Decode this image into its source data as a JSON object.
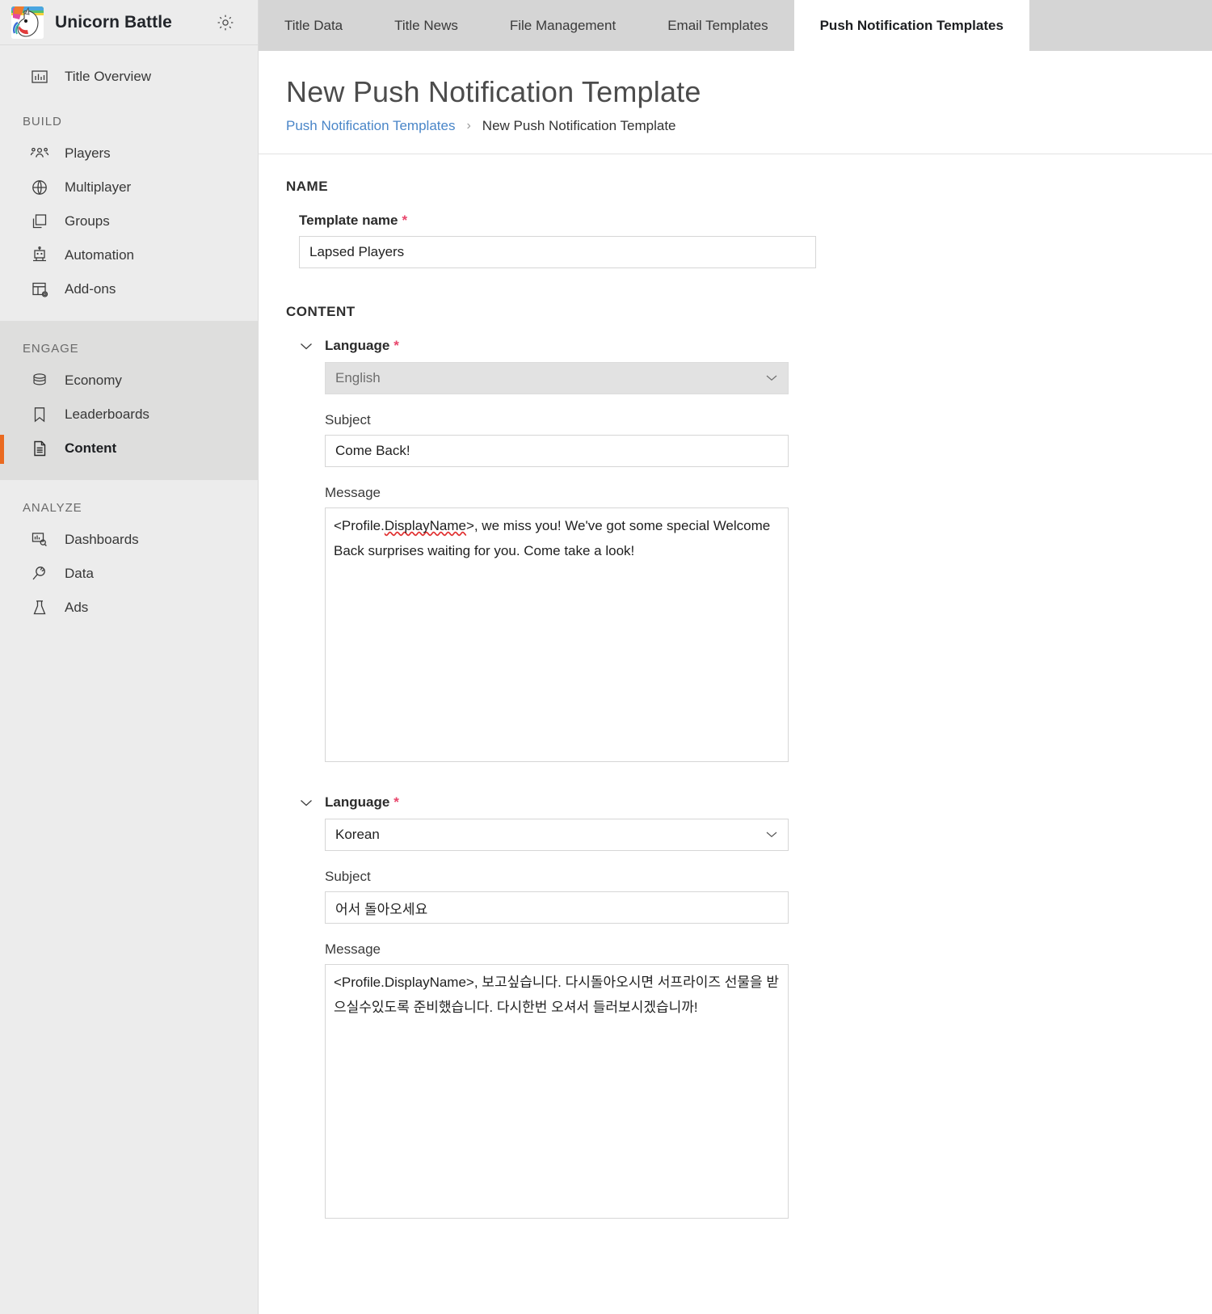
{
  "sidebar": {
    "brand": {
      "title": "Unicorn Battle",
      "logo_icon": "unicorn-logo",
      "settings_icon": "gear-icon"
    },
    "top_items": [
      {
        "label": "Title Overview",
        "icon": "bar-chart-icon"
      }
    ],
    "sections": [
      {
        "label": "BUILD",
        "items": [
          {
            "label": "Players",
            "icon": "people-icon"
          },
          {
            "label": "Multiplayer",
            "icon": "globe-icon"
          },
          {
            "label": "Groups",
            "icon": "stacked-squares-icon"
          },
          {
            "label": "Automation",
            "icon": "robot-icon"
          },
          {
            "label": "Add-ons",
            "icon": "addons-grid-icon"
          }
        ]
      },
      {
        "label": "ENGAGE",
        "items": [
          {
            "label": "Economy",
            "icon": "coins-stack-icon"
          },
          {
            "label": "Leaderboards",
            "icon": "bookmark-icon"
          },
          {
            "label": "Content",
            "icon": "document-icon",
            "active": true
          }
        ]
      },
      {
        "label": "ANALYZE",
        "items": [
          {
            "label": "Dashboards",
            "icon": "dashboard-search-icon"
          },
          {
            "label": "Data",
            "icon": "plug-icon"
          },
          {
            "label": "Ads",
            "icon": "flask-icon"
          }
        ]
      }
    ],
    "accent_color": "#ea6a20"
  },
  "tabs": [
    {
      "label": "Title Data",
      "active": false
    },
    {
      "label": "Title News",
      "active": false
    },
    {
      "label": "File Management",
      "active": false
    },
    {
      "label": "Email Templates",
      "active": false
    },
    {
      "label": "Push Notification Templates",
      "active": true
    }
  ],
  "page": {
    "title": "New Push Notification Template",
    "breadcrumb": {
      "link": "Push Notification Templates",
      "separator": "›",
      "current": "New Push Notification Template"
    }
  },
  "name_section": {
    "heading": "NAME",
    "template_name": {
      "label": "Template name",
      "required_marker": "*",
      "value": "Lapsed Players",
      "placeholder": ""
    }
  },
  "content_section": {
    "heading": "CONTENT",
    "languages": [
      {
        "collapse_icon": "chevron-down-icon",
        "language_label": "Language",
        "required_marker": "*",
        "language_value": "English",
        "language_disabled": true,
        "subject_label": "Subject",
        "subject_value": "Come Back!",
        "message_label": "Message",
        "message_prefix": "<Profile.",
        "message_spell": "DisplayName",
        "message_suffix": ">, we miss you! We've got some special Welcome Back surprises waiting for you. Come take a look!",
        "message_value": "<Profile.DisplayName>, we miss you! We've got some special Welcome Back surprises waiting for you. Come take a look!"
      },
      {
        "collapse_icon": "chevron-down-icon",
        "language_label": "Language",
        "required_marker": "*",
        "language_value": "Korean",
        "language_disabled": false,
        "subject_label": "Subject",
        "subject_value": "어서 돌아오세요",
        "message_label": "Message",
        "message_value": "<Profile.DisplayName>, 보고싶습니다. 다시돌아오시면 서프라이즈 선물을 받으실수있도록 준비했습니다. 다시한번 오셔서 들러보시겠습니까!"
      }
    ]
  }
}
